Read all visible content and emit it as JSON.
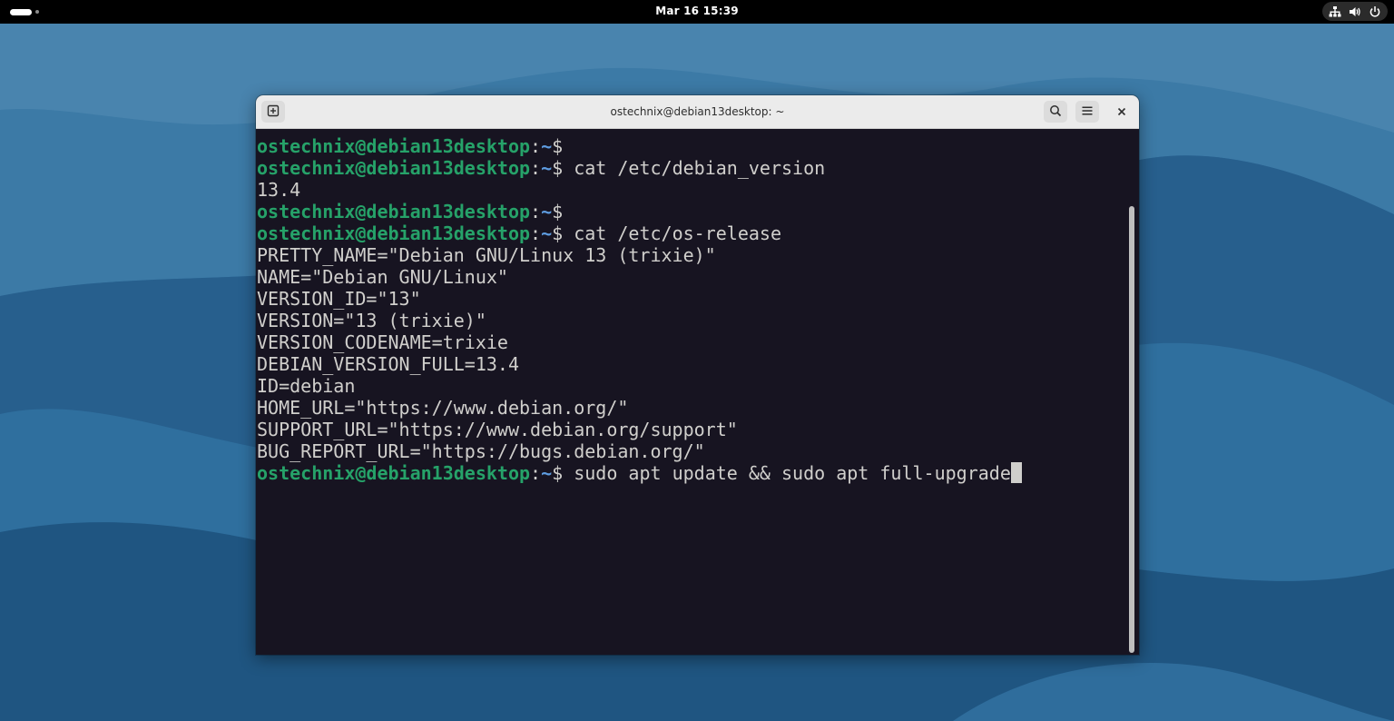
{
  "topbar": {
    "clock": "Mar 16  15:39",
    "tray_icons": [
      "network-icon",
      "volume-icon",
      "power-icon"
    ]
  },
  "window": {
    "title": "ostechnix@debian13desktop: ~"
  },
  "terminal": {
    "prompt_user": "ostechnix@debian13desktop",
    "prompt_sep": ":",
    "prompt_path": "~",
    "prompt_symbol": "$",
    "lines": [
      {
        "type": "prompt",
        "command": ""
      },
      {
        "type": "prompt",
        "command": " cat /etc/debian_version"
      },
      {
        "type": "output",
        "text": "13.4"
      },
      {
        "type": "prompt",
        "command": ""
      },
      {
        "type": "prompt",
        "command": " cat /etc/os-release"
      },
      {
        "type": "output",
        "text": "PRETTY_NAME=\"Debian GNU/Linux 13 (trixie)\""
      },
      {
        "type": "output",
        "text": "NAME=\"Debian GNU/Linux\""
      },
      {
        "type": "output",
        "text": "VERSION_ID=\"13\""
      },
      {
        "type": "output",
        "text": "VERSION=\"13 (trixie)\""
      },
      {
        "type": "output",
        "text": "VERSION_CODENAME=trixie"
      },
      {
        "type": "output",
        "text": "DEBIAN_VERSION_FULL=13.4"
      },
      {
        "type": "output",
        "text": "ID=debian"
      },
      {
        "type": "output",
        "text": "HOME_URL=\"https://www.debian.org/\""
      },
      {
        "type": "output",
        "text": "SUPPORT_URL=\"https://www.debian.org/support\""
      },
      {
        "type": "output",
        "text": "BUG_REPORT_URL=\"https://bugs.debian.org/\""
      },
      {
        "type": "prompt",
        "command": " sudo apt update && sudo apt full-upgrade",
        "cursor": true
      }
    ]
  },
  "colors": {
    "user": "#26a269",
    "path": "#5e9ce0",
    "terminal_bg": "#171421",
    "terminal_fg": "#d0cfcc"
  }
}
